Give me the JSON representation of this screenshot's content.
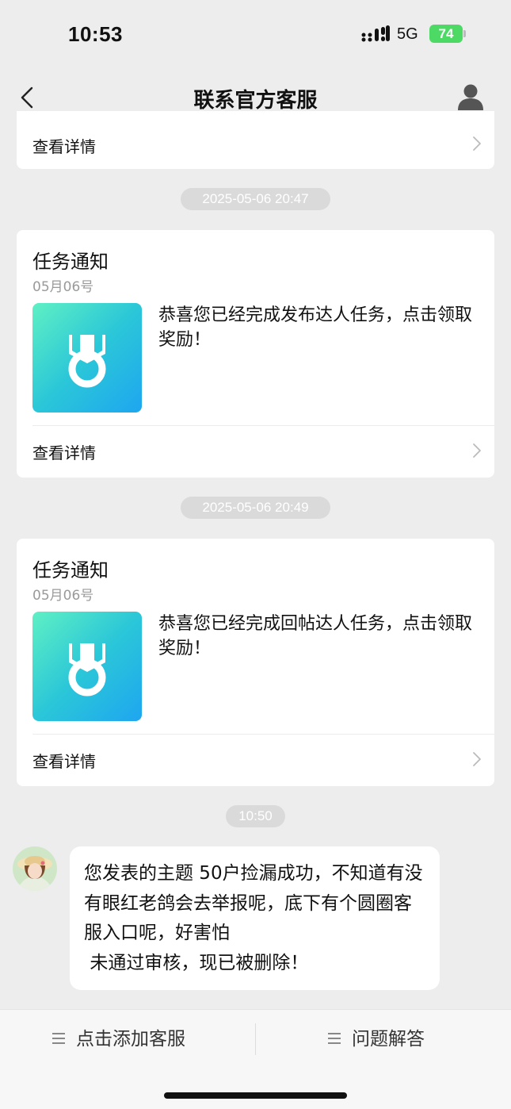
{
  "status_bar": {
    "time": "10:53",
    "network": "5G",
    "battery": "74"
  },
  "navbar": {
    "title": "联系官方客服"
  },
  "cards": [
    {
      "link": "查看详情"
    },
    {
      "timestamp": "2025-05-06 20:47",
      "title": "任务通知",
      "date": "05月06号",
      "text": "恭喜您已经完成发布达人任务，点击领取奖励！",
      "link": "查看详情"
    },
    {
      "timestamp": "2025-05-06 20:49",
      "title": "任务通知",
      "date": "05月06号",
      "text": "恭喜您已经完成回帖达人任务，点击领取奖励！",
      "link": "查看详情"
    }
  ],
  "chat": {
    "timestamp": "10:50",
    "message": "您发表的主题 50户捡漏成功，不知道有没有眼红老鸽会去举报呢，底下有个圆圈客服入口呢，好害怕\n 未通过审核，现已被删除！"
  },
  "bottom_bar": {
    "left_tab": "点击添加客服",
    "right_tab": "问题解答"
  },
  "colors": {
    "thumb_gradient_start": "#5ff0c4",
    "thumb_gradient_end": "#1ea6f0",
    "battery": "#4cd964"
  }
}
